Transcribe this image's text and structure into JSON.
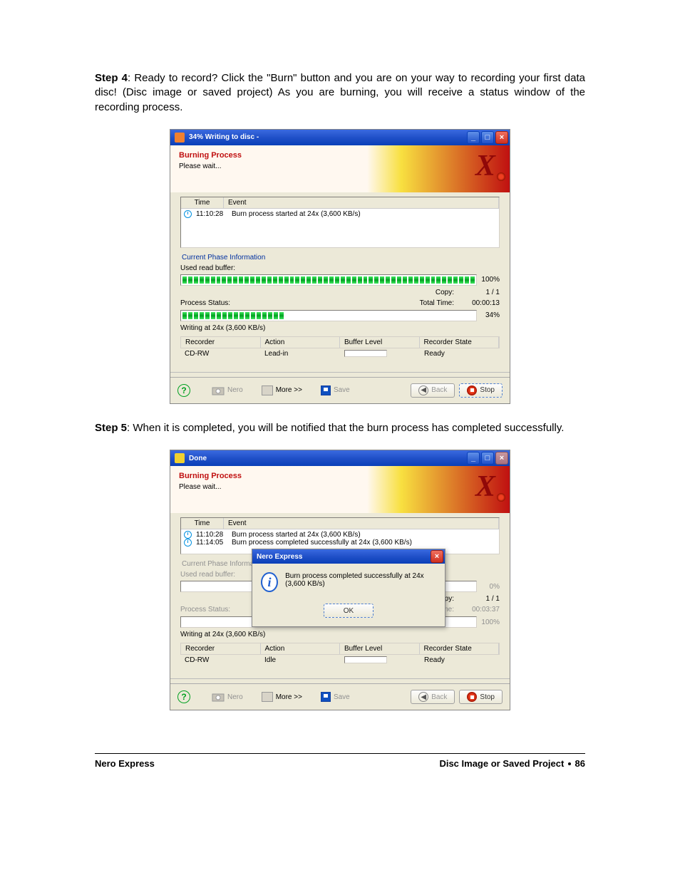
{
  "steps": {
    "step4": {
      "label": "Step 4",
      "text": ": Ready to record? Click the \"Burn\" button and you are on your way to recording your first data disc! (Disc image or saved project) As you are burning, you will receive a status window of the recording process."
    },
    "step5": {
      "label": "Step 5",
      "text": ": When it is completed, you will be notified that the burn process has completed successfully."
    }
  },
  "win1": {
    "title": "34% Writing to disc -",
    "header_title": "Burning Process",
    "header_sub": "Please wait...",
    "evt_headers": {
      "time": "Time",
      "event": "Event"
    },
    "events": [
      {
        "time": "11:10:28",
        "text": "Burn process started at 24x (3,600 KB/s)"
      }
    ],
    "phase_label": "Current Phase Information",
    "buffer_label": "Used read buffer:",
    "buffer_pct": "100%",
    "buffer_fill_ratio": 1.0,
    "copy_label": "Copy:",
    "copy_val": "1 / 1",
    "total_label": "Total Time:",
    "total_val": "00:00:13",
    "status_label": "Process Status:",
    "process_pct": "34%",
    "process_fill_ratio": 0.34,
    "writing_at": "Writing at 24x (3,600 KB/s)",
    "rec_headers": {
      "recorder": "Recorder",
      "action": "Action",
      "buffer": "Buffer Level",
      "state": "Recorder State"
    },
    "rec_row": {
      "recorder": "CD-RW",
      "action": "Lead-in",
      "state": "Ready"
    },
    "buttons": {
      "nero": "Nero",
      "more": "More >>",
      "save": "Save",
      "back": "Back",
      "stop": "Stop"
    }
  },
  "win2": {
    "title": "Done",
    "header_title": "Burning Process",
    "header_sub": "Please wait...",
    "evt_headers": {
      "time": "Time",
      "event": "Event"
    },
    "events": [
      {
        "time": "11:10:28",
        "text": "Burn process started at 24x (3,600 KB/s)"
      },
      {
        "time": "11:14:05",
        "text": "Burn process completed successfully at 24x (3,600 KB/s)"
      }
    ],
    "phase_label": "Current Phase Information",
    "buffer_label": "Used read buffer:",
    "buffer_pct": "0%",
    "copy_label": "Copy:",
    "copy_val": "1 / 1",
    "total_label": "Total Time:",
    "total_val": "00:03:37",
    "status_label": "Process Status:",
    "process_pct": "100%",
    "writing_at": "Writing at 24x (3,600 KB/s)",
    "rec_headers": {
      "recorder": "Recorder",
      "action": "Action",
      "buffer": "Buffer Level",
      "state": "Recorder State"
    },
    "rec_row": {
      "recorder": "CD-RW",
      "action": "Idle",
      "state": "Ready"
    },
    "buttons": {
      "nero": "Nero",
      "more": "More >>",
      "save": "Save",
      "back": "Back",
      "stop": "Stop"
    },
    "modal": {
      "title": "Nero Express",
      "message": "Burn process completed successfully at 24x (3,600 KB/s)",
      "ok": "OK"
    }
  },
  "footer": {
    "left": "Nero Express",
    "right_a": "Disc Image or Saved Project ",
    "right_b": " 86"
  }
}
